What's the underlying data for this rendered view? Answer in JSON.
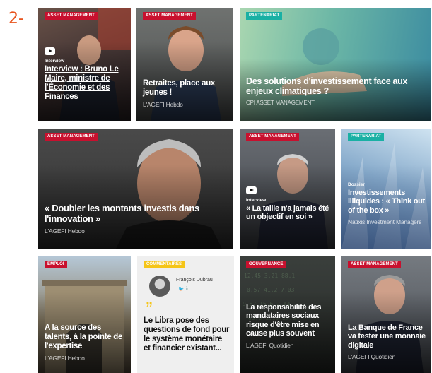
{
  "step_label": "2-",
  "cards": {
    "c1": {
      "tag": "ASSET MANAGEMENT",
      "kicker": "Interview",
      "title": "Interview : Bruno Le Maire, ministre de l'Économie et des Finances"
    },
    "c2": {
      "tag": "ASSET MANAGEMENT",
      "title": "Retraites, place aux jeunes !",
      "source": "L'AGEFI Hebdo"
    },
    "c3": {
      "tag": "PARTENARIAT",
      "title": "Des solutions d'investissement face aux enjeux climatiques ?",
      "source": "CPI ASSET MANAGEMENT"
    },
    "c4": {
      "tag": "ASSET MANAGEMENT",
      "title": "« Doubler les montants investis dans l'innovation »",
      "source": "L'AGEFI Hebdo"
    },
    "c5": {
      "tag": "ASSET MANAGEMENT",
      "kicker": "Interview",
      "title": "« La taille n'a jamais été un objectif en soi »"
    },
    "c6": {
      "tag": "PARTENARIAT",
      "kicker": "Dossier",
      "title": "Investissements illiquides : « Think out of the box »",
      "source": "Natixis Investment Managers"
    },
    "c7": {
      "tag": "EMPLOI",
      "title": "A la source des talents, à la pointe de l'expertise",
      "source": "L'AGEFI Hebdo"
    },
    "c8": {
      "tag": "COMMENTAIRES",
      "author": "François Dubrau",
      "social": "🐦 in",
      "quote_mark": "”",
      "title": "Le Libra pose des questions de fond pour le système monétaire et financier existant..."
    },
    "c9": {
      "tag": "GOUVERNANCE",
      "title": "La responsabilité des mandataires sociaux risque d'être mise en cause plus souvent",
      "source": "L'AGEFI Quotidien"
    },
    "c10": {
      "tag": "ASSET MANAGEMENT",
      "title": "La Banque de France va tester une monnaie digitale",
      "source": "L'AGEFI Quotidien"
    }
  },
  "colors": {
    "accent": "#e8541e",
    "tag_red": "#c8102e",
    "tag_teal": "#19b0a4",
    "tag_yellow": "#f5c518"
  }
}
